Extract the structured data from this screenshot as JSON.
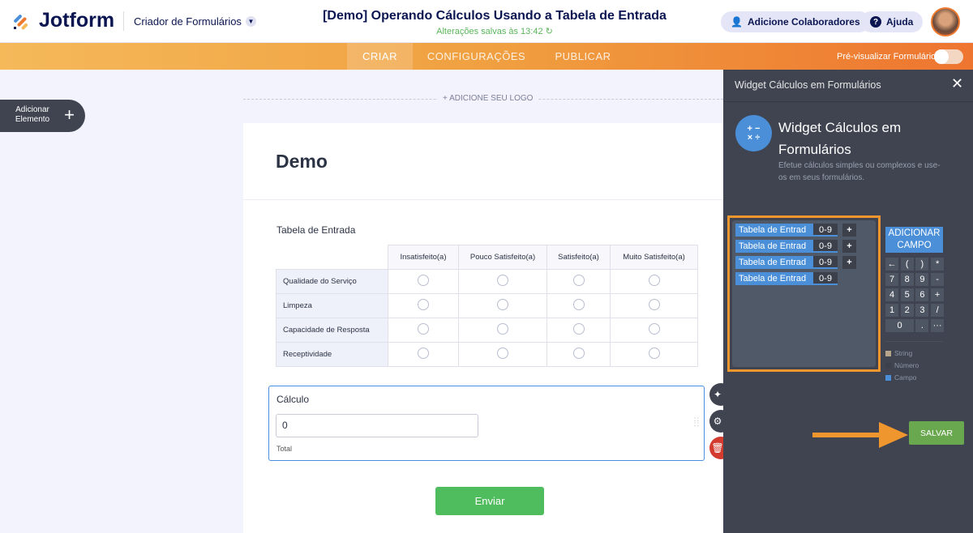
{
  "header": {
    "logo": "Jotform",
    "builder": "Criador de Formulários",
    "title": "[Demo] Operando Cálculos Usando a Tabela de Entrada",
    "saved": "Alterações salvas às 13:42",
    "collaborators": "Adicione Colaboradores",
    "help": "Ajuda"
  },
  "nav": {
    "tabs": [
      "CRIAR",
      "CONFIGURAÇÕES",
      "PUBLICAR"
    ],
    "active": "CRIAR",
    "preview": "Pré-visualizar Formulário",
    "preview_on": false
  },
  "left": {
    "add_element": "Adicionar\nElemento",
    "add_logo": "+ ADICIONE SEU LOGO"
  },
  "form": {
    "heading": "Demo",
    "table_label": "Tabela de Entrada",
    "columns": [
      "Insatisfeito(a)",
      "Pouco Satisfeito(a)",
      "Satisfeito(a)",
      "Muito Satisfeito(a)"
    ],
    "rows": [
      "Qualidade do Serviço",
      "Limpeza",
      "Capacidade de Resposta",
      "Receptividade"
    ],
    "calc_label": "Cálculo",
    "calc_value": "0",
    "calc_sub": "Total",
    "submit": "Enviar"
  },
  "panel": {
    "header": "Widget Cálculos em Formulários",
    "title": "Widget Cálculos em Formulários",
    "desc": "Efetue cálculos simples ou complexos e use-os em seus formulários.",
    "fields": [
      {
        "name": "Tabela de Entrad",
        "range": "0-9",
        "plus": "+"
      },
      {
        "name": "Tabela de Entrad",
        "range": "0-9",
        "plus": "+"
      },
      {
        "name": "Tabela de Entrad",
        "range": "0-9",
        "plus": "+"
      },
      {
        "name": "Tabela de Entrad",
        "range": "0-9"
      }
    ],
    "add_field": "ADICIONAR CAMPO",
    "keys": [
      "←",
      "(",
      ")",
      "*",
      "7",
      "8",
      "9",
      "-",
      "4",
      "5",
      "6",
      "+",
      "1",
      "2",
      "3",
      "/",
      "0",
      ".",
      "···"
    ],
    "legend": [
      "String",
      "Número",
      "Campo"
    ],
    "legend_colors": [
      "#b5a58a",
      "#3b404b",
      "#4a8fd8"
    ],
    "save": "SALVAR"
  }
}
